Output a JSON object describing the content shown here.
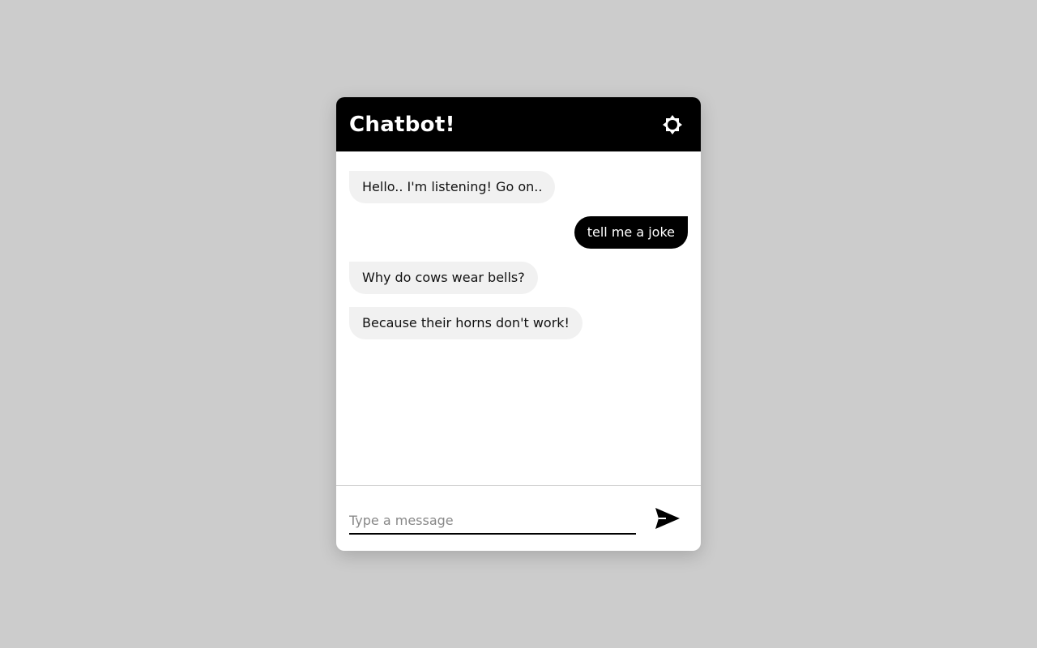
{
  "header": {
    "title": "Chatbot!",
    "theme_icon": "sun-icon"
  },
  "messages": [
    {
      "sender": "bot",
      "text": "Hello.. I'm listening! Go on.."
    },
    {
      "sender": "user",
      "text": "tell me a joke"
    },
    {
      "sender": "bot",
      "text": "Why do cows wear bells?"
    },
    {
      "sender": "bot",
      "text": "Because their horns don't work!"
    }
  ],
  "composer": {
    "placeholder": "Type a message",
    "value": "",
    "send_icon": "send-icon"
  },
  "colors": {
    "page_background": "#cccccc",
    "header_background": "#000000",
    "bot_bubble": "#f1f1f1",
    "user_bubble": "#000000"
  }
}
